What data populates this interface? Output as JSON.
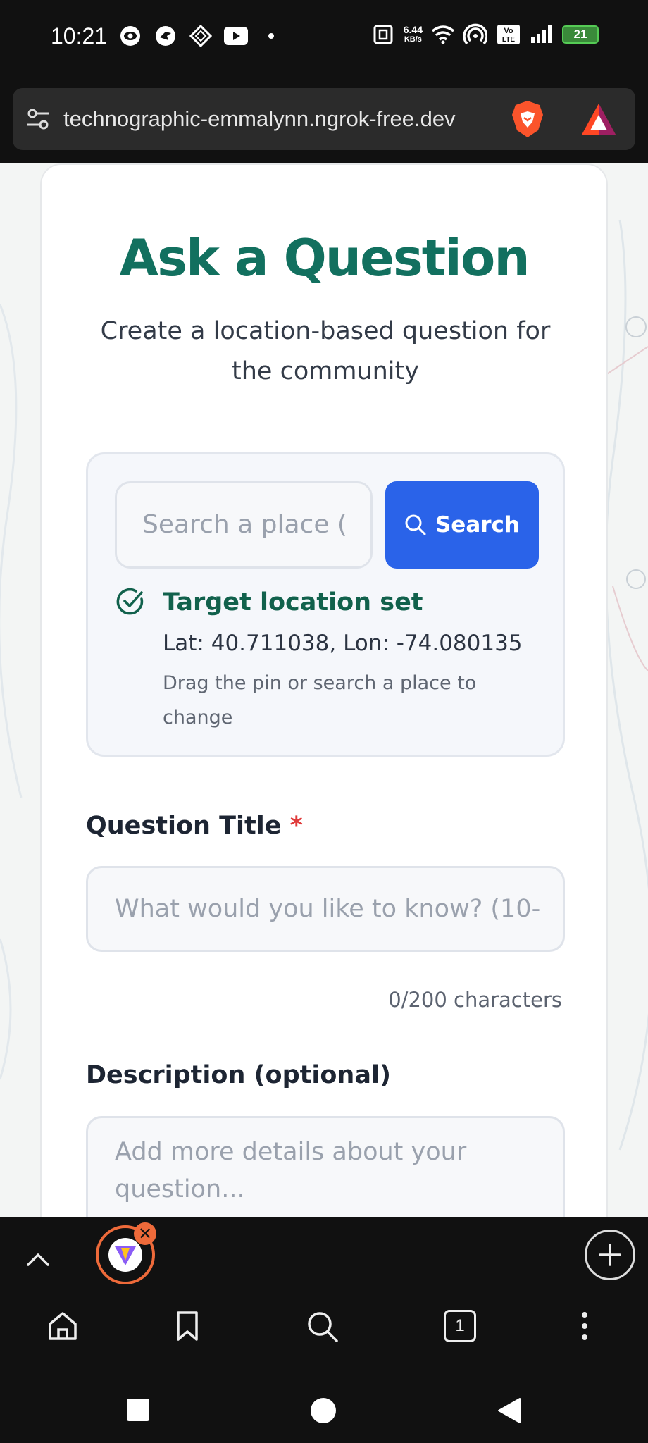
{
  "status_bar": {
    "time": "10:21",
    "net_speed_value": "6.44",
    "net_speed_unit": "KB/s",
    "volte": "Vo LTE",
    "battery": "21"
  },
  "browser": {
    "url": "technographic-emmalynn.ngrok-free.dev",
    "tab_count": "1"
  },
  "page": {
    "title": "Ask a Question",
    "subtitle": "Create a location-based question for the community",
    "location": {
      "search_placeholder": "Search a place (",
      "search_button": "Search",
      "status_label": "Target location set",
      "coords": "Lat: 40.711038, Lon: -74.080135",
      "hint": "Drag the pin or search a place to change"
    },
    "question_title": {
      "label": "Question Title",
      "required_mark": "*",
      "placeholder": "What would you like to know? (10-",
      "char_count": "0/200 characters"
    },
    "description": {
      "label": "Description (optional)",
      "placeholder": "Add more details about your question..."
    }
  },
  "colors": {
    "accent": "#12705f",
    "button": "#2a63e9",
    "required": "#e03b3b"
  }
}
